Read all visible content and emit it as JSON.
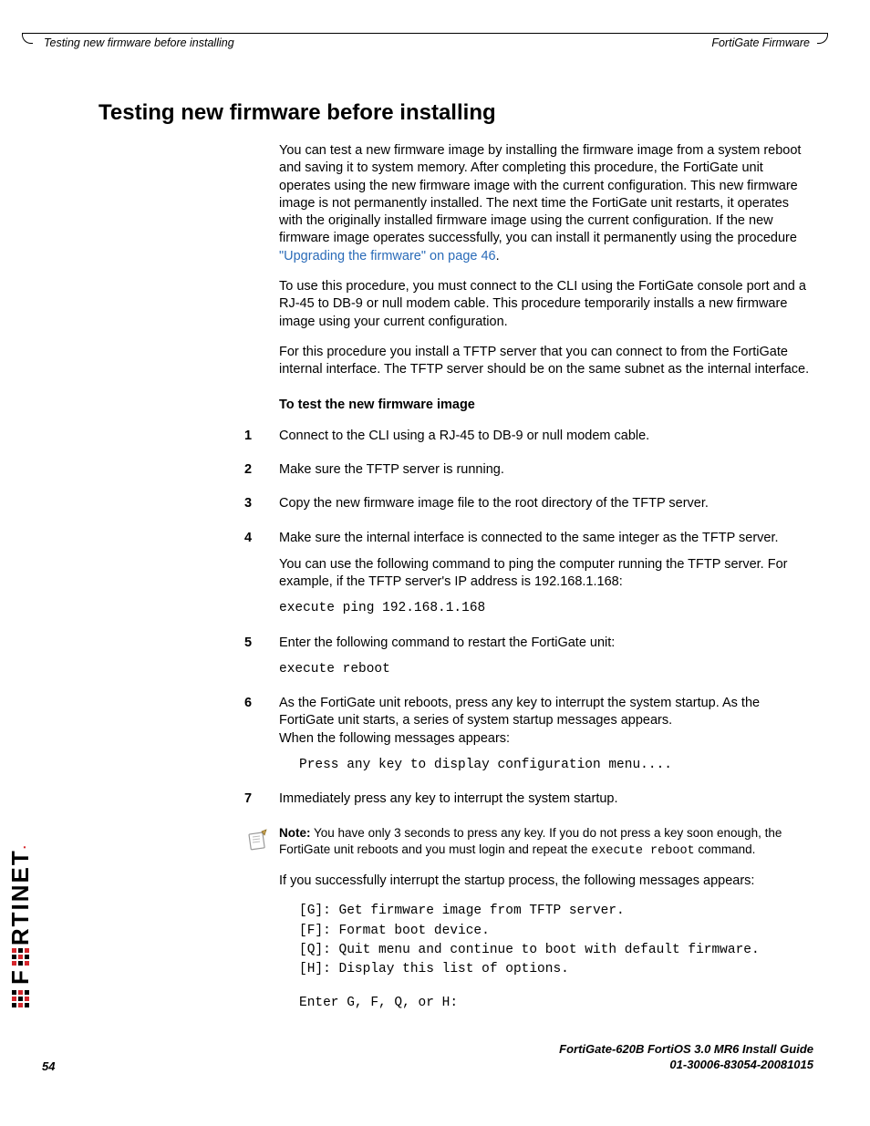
{
  "header": {
    "left": "Testing new firmware before installing",
    "right": "FortiGate Firmware"
  },
  "title": "Testing new firmware before installing",
  "p1a": "You can test a new firmware image by installing the firmware image from a system reboot and saving it to system memory. After completing this procedure, the FortiGate unit operates using the new firmware image with the current configuration. This new firmware image is not permanently installed. The next time the FortiGate unit restarts, it operates with the originally installed firmware image using the current configuration. If the new firmware image operates successfully, you can install it permanently using the procedure ",
  "p1link": "\"Upgrading the firmware\" on page 46",
  "p1b": ".",
  "p2": "To use this procedure, you must connect to the CLI using the FortiGate console port and a RJ-45 to DB-9 or null modem cable. This procedure temporarily installs a new firmware image using your current configuration.",
  "p3": "For this procedure you install a TFTP server that you can connect to from the FortiGate internal interface. The TFTP server should be on the same subnet as the internal interface.",
  "subhead": "To test the new firmware image",
  "steps": {
    "s1": "Connect to the CLI using a RJ-45 to DB-9 or null modem cable.",
    "s2": "Make sure the TFTP server is running.",
    "s3": "Copy the new firmware image file to the root directory of the TFTP server.",
    "s4a": "Make sure the internal interface is connected to the same integer as the TFTP server.",
    "s4b": "You can use the following command to ping the computer running the TFTP server. For example, if the TFTP server's IP address is 192.168.1.168:",
    "s4code": "execute ping 192.168.1.168",
    "s5a": "Enter the following command to restart the FortiGate unit:",
    "s5code": "execute reboot",
    "s6a": "As the FortiGate unit reboots, press any key to interrupt the system startup. As the FortiGate unit starts, a series of system startup messages appears.",
    "s6b": "When the following messages appears:",
    "s6code": "Press any key to display configuration menu....",
    "s7": "Immediately press any key to interrupt the system startup."
  },
  "note": {
    "label": "Note:",
    "body1": " You have only 3 seconds to press any key. If you do not press a key soon enough, the ",
    "body2": "FortiGate",
    "body3": " unit reboots and you must login and repeat the ",
    "code": "execute reboot",
    "body4": " command."
  },
  "after_note": "If you successfully interrupt the startup process, the following messages appears:",
  "menu": {
    "l1": "[G]: Get firmware image from TFTP server.",
    "l2": "[F]: Format boot device.",
    "l3": "[Q]: Quit menu and continue to boot with default firmware.",
    "l4": "[H]: Display this list of options.",
    "l5": "Enter G, F, Q, or H:"
  },
  "footer": {
    "page": "54",
    "guide_l1": "FortiGate-620B FortiOS 3.0 MR6 Install Guide",
    "guide_l2": "01-30006-83054-20081015"
  },
  "brand": "F   RTINET"
}
